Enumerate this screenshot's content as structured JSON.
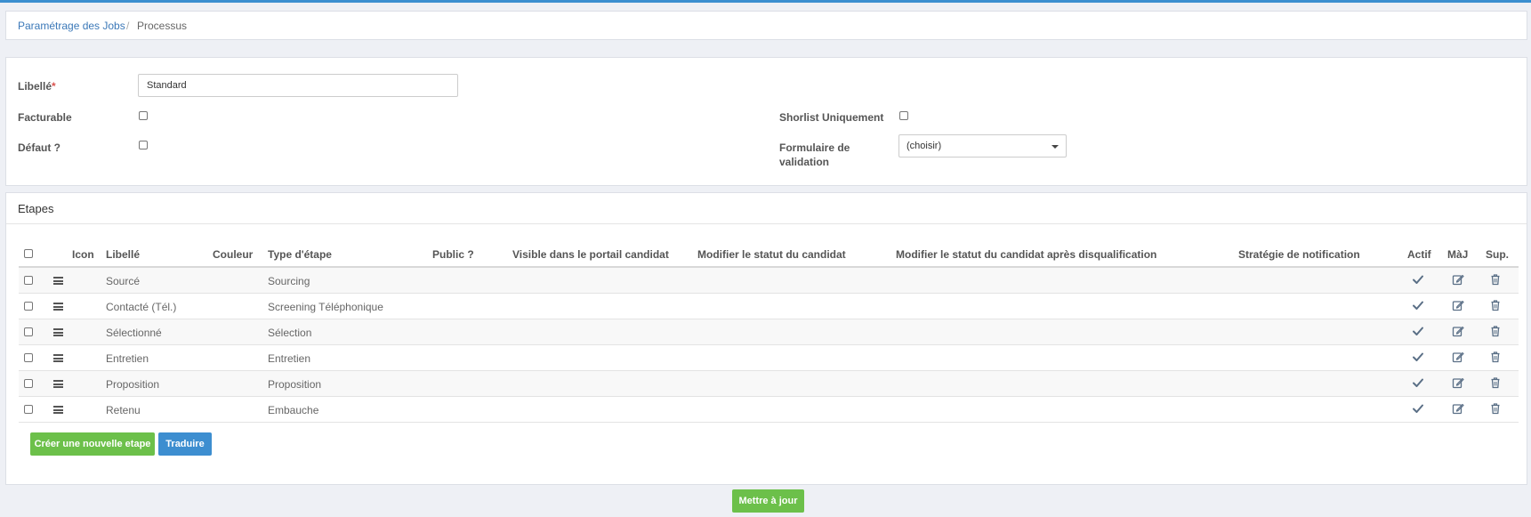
{
  "breadcrumb": {
    "parent": "Paramétrage des Jobs",
    "separator": "/",
    "current": "Processus"
  },
  "form": {
    "libelle_label": "Libellé",
    "required_mark": "*",
    "libelle_value": "Standard",
    "facturable_label": "Facturable",
    "defaut_label": "Défaut ?",
    "shortlist_label": "Shorlist Uniquement",
    "formulaire_label_1": "Formulaire de",
    "formulaire_label_2": "validation",
    "formulaire_value": "(choisir)"
  },
  "steps": {
    "title": "Etapes",
    "headers": {
      "icon": "Icon",
      "libelle": "Libellé",
      "couleur": "Couleur",
      "type": "Type d'étape",
      "public": "Public ?",
      "visible": "Visible dans le portail candidat",
      "modifier": "Modifier le statut du candidat",
      "modifier_disq": "Modifier le statut du candidat après disqualification",
      "strategie": "Stratégie de notification",
      "actif": "Actif",
      "maj": "MàJ",
      "sup": "Sup."
    },
    "rows": [
      {
        "libelle": "Sourcé",
        "type": "Sourcing"
      },
      {
        "libelle": "Contacté (Tél.)",
        "type": "Screening Téléphonique"
      },
      {
        "libelle": "Sélectionné",
        "type": "Sélection"
      },
      {
        "libelle": "Entretien",
        "type": "Entretien"
      },
      {
        "libelle": "Proposition",
        "type": "Proposition"
      },
      {
        "libelle": "Retenu",
        "type": "Embauche"
      }
    ],
    "create_button": "Créer une nouvelle etape",
    "translate_button": "Traduire"
  },
  "update_button": "Mettre à jour",
  "colors": {
    "accent_blue": "#3d8ed0",
    "accent_green": "#6cc04a",
    "link": "#3b78b8",
    "required": "#d9534f"
  },
  "icons": {
    "drag": "hamburger-icon",
    "active": "check-icon",
    "edit": "edit-icon",
    "delete": "trash-icon"
  }
}
